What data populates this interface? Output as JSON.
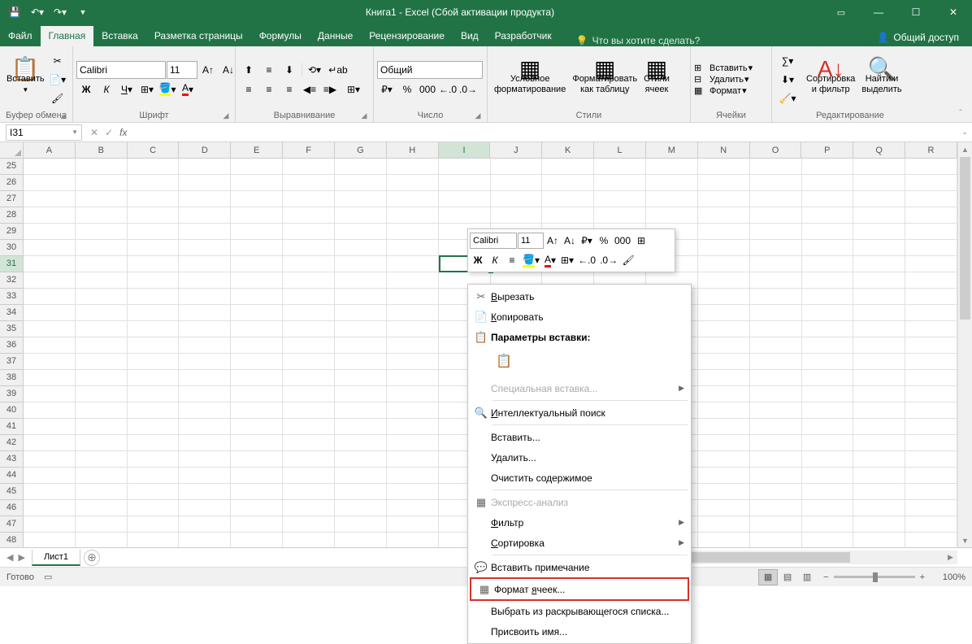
{
  "app": {
    "title": "Книга1 - Excel (Сбой активации продукта)"
  },
  "tabs": {
    "file": "Файл",
    "home": "Главная",
    "insert": "Вставка",
    "pagelayout": "Разметка страницы",
    "formulas": "Формулы",
    "data": "Данные",
    "review": "Рецензирование",
    "view": "Вид",
    "developer": "Разработчик",
    "tell": "Что вы хотите сделать?",
    "share": "Общий доступ"
  },
  "ribbon": {
    "clipboard": {
      "label": "Буфер обмена",
      "paste": "Вставить"
    },
    "font": {
      "label": "Шрифт",
      "name": "Calibri",
      "size": "11"
    },
    "alignment": {
      "label": "Выравнивание"
    },
    "number": {
      "label": "Число",
      "format": "Общий"
    },
    "styles": {
      "label": "Стили",
      "conditional": "Условное\nформатирование",
      "table": "Форматировать\nкак таблицу",
      "cell": "Стили\nячеек"
    },
    "cells": {
      "label": "Ячейки",
      "insert": "Вставить",
      "delete": "Удалить",
      "format": "Формат"
    },
    "editing": {
      "label": "Редактирование",
      "sort": "Сортировка\nи фильтр",
      "find": "Найти и\nвыделить"
    }
  },
  "namebox": "I31",
  "columns": [
    "A",
    "B",
    "C",
    "D",
    "E",
    "F",
    "G",
    "H",
    "I",
    "J",
    "K",
    "L",
    "M",
    "N",
    "O",
    "P",
    "Q",
    "R"
  ],
  "rows_start": 25,
  "rows_end": 48,
  "selected_col": "I",
  "selected_row": 31,
  "sheet": {
    "name": "Лист1"
  },
  "status": {
    "ready": "Готово",
    "zoom": "100%"
  },
  "minibar": {
    "font": "Calibri",
    "size": "11"
  },
  "ctx": {
    "cut": "Вырезать",
    "copy": "Копировать",
    "paste_header": "Параметры вставки:",
    "paste_special": "Специальная вставка...",
    "smart_lookup": "Интеллектуальный поиск",
    "insert": "Вставить...",
    "delete": "Удалить...",
    "clear": "Очистить содержимое",
    "quick_analysis": "Экспресс-анализ",
    "filter": "Фильтр",
    "sort": "Сортировка",
    "comment": "Вставить примечание",
    "format_cells": "Формат ячеек...",
    "dropdown": "Выбрать из раскрывающегося списка...",
    "define_name": "Присвоить имя..."
  }
}
